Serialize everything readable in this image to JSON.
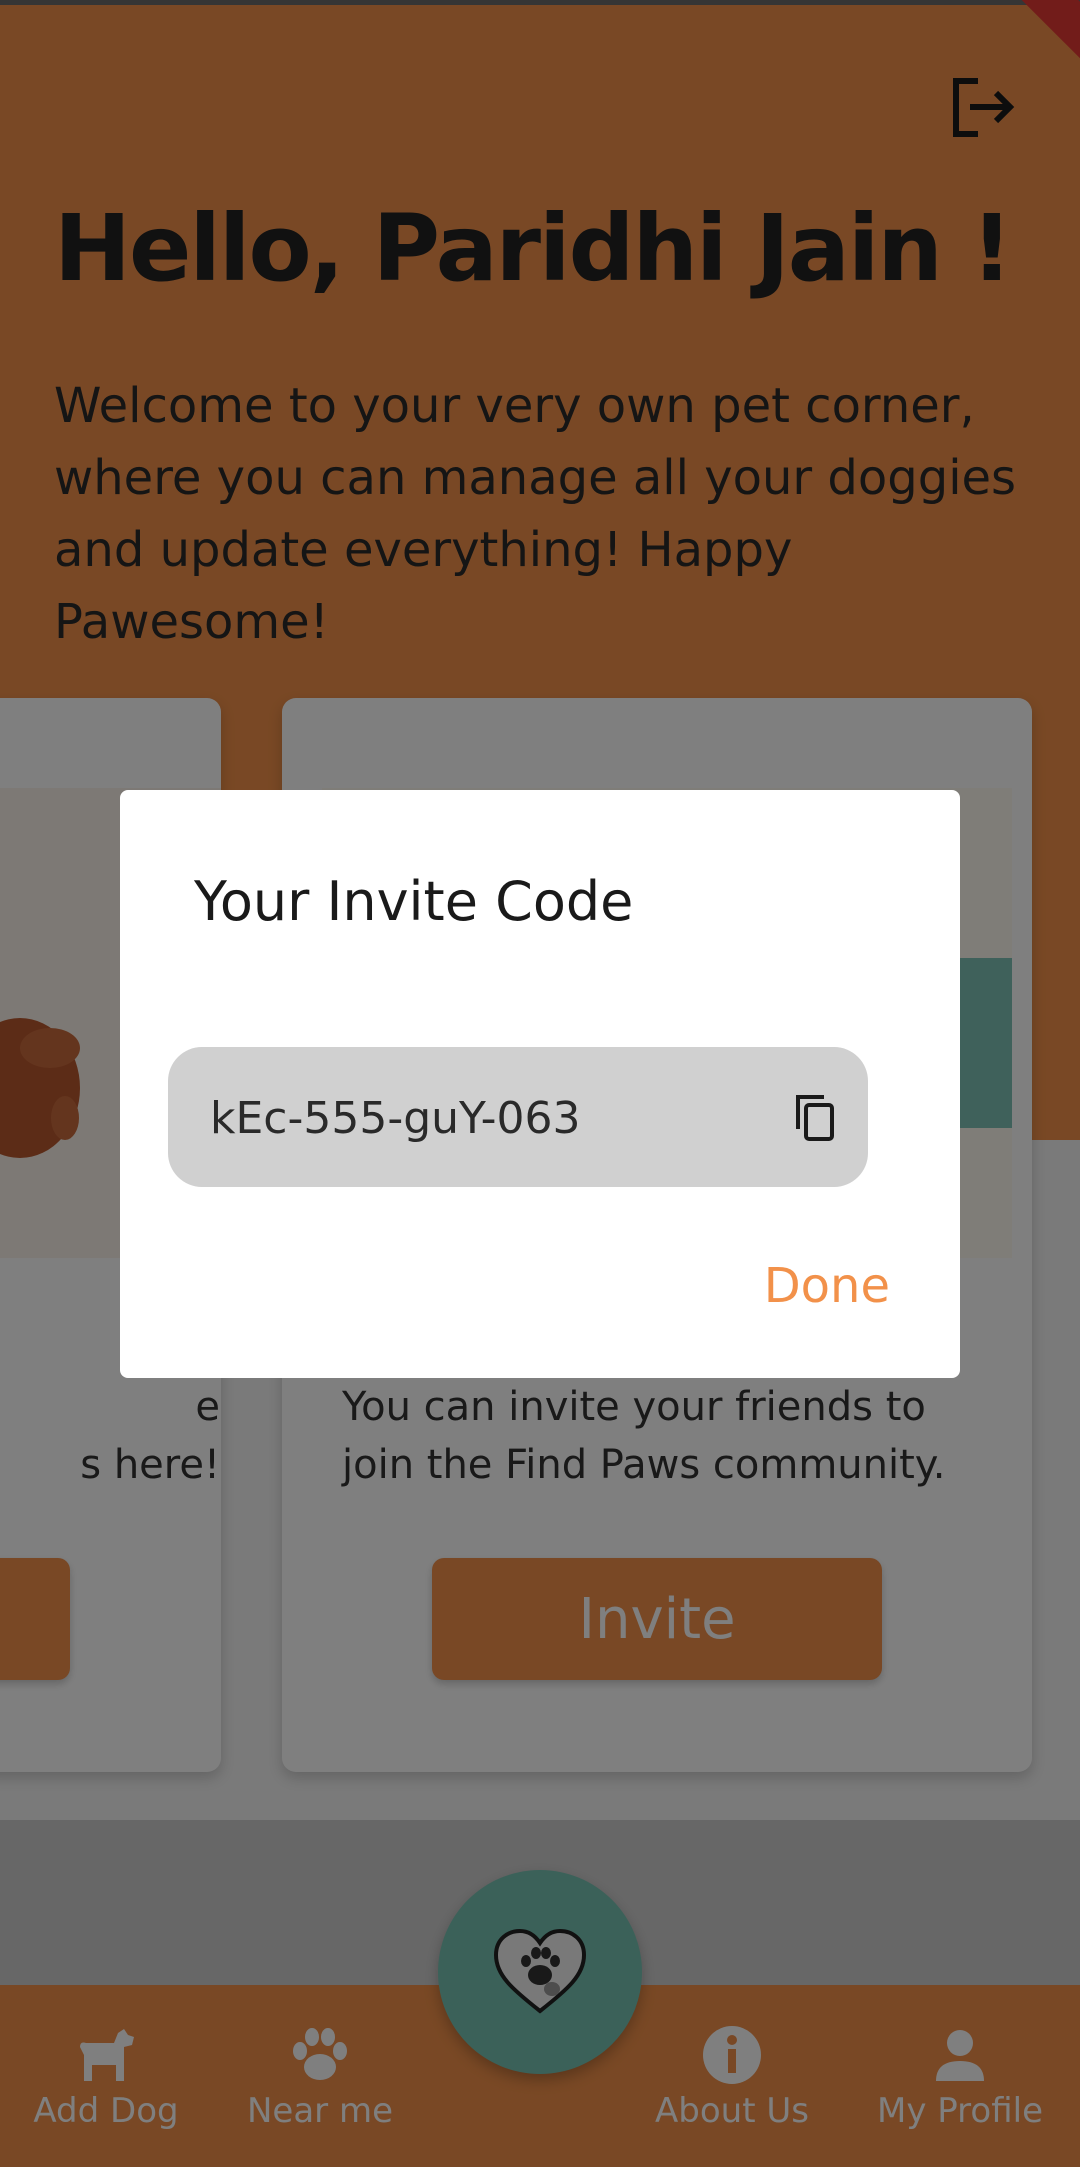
{
  "header": {
    "greeting": "Hello, Paridhi Jain !",
    "welcome": "Welcome to your very own pet corner, where you can manage all your doggies and update everything! Happy Pawesome!"
  },
  "cards": {
    "left": {
      "text_line1": "e",
      "text_line2": "s here!"
    },
    "right": {
      "text": "You can invite your friends to join the Find Paws community.",
      "button": "Invite"
    }
  },
  "dialog": {
    "title": "Your Invite Code",
    "code": "kEc-555-guY-063",
    "done": "Done"
  },
  "bottom_nav": {
    "items": [
      {
        "label": "Add Dog",
        "icon": "dog-icon"
      },
      {
        "label": "Near me",
        "icon": "paw-icon"
      },
      {
        "label": "About Us",
        "icon": "info-icon"
      },
      {
        "label": "My Profile",
        "icon": "person-icon"
      }
    ]
  },
  "colors": {
    "brand_orange": "#f2914a",
    "teal": "#77c3b3"
  }
}
